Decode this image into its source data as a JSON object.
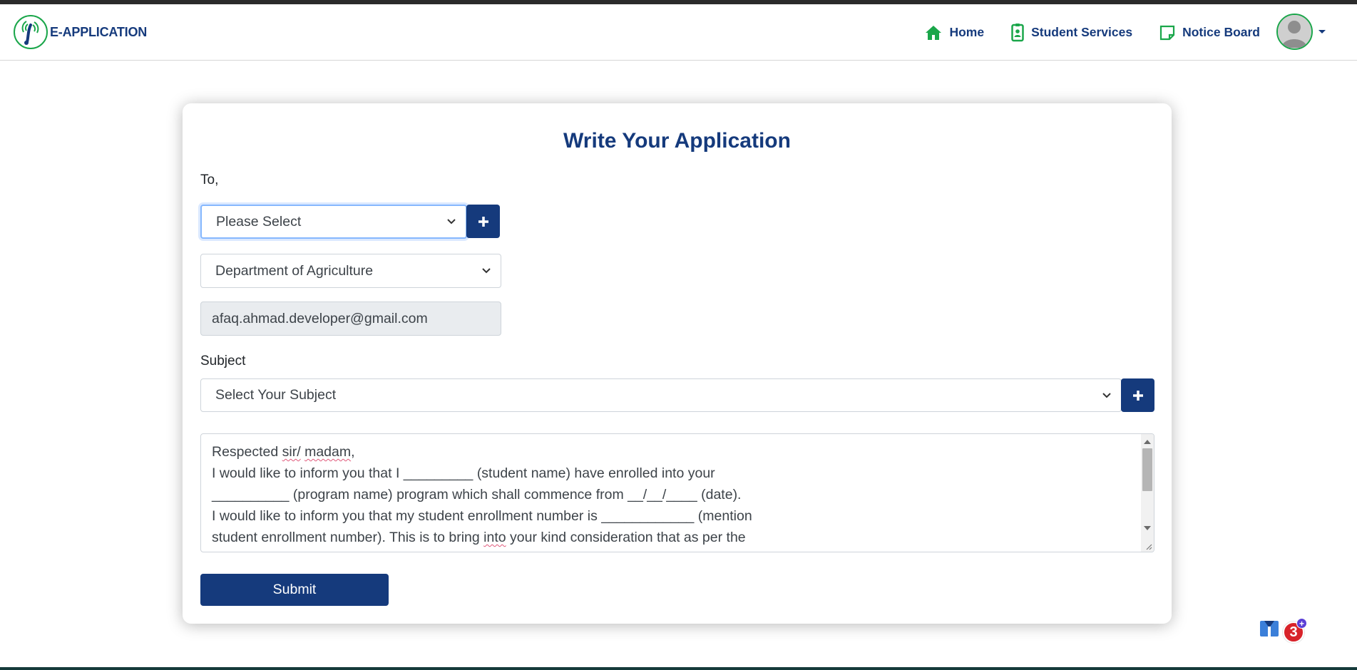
{
  "app": {
    "brand_name": "E-APPLICATION"
  },
  "nav": {
    "items": [
      {
        "label": "Home",
        "icon": "home-icon"
      },
      {
        "label": "Student Services",
        "icon": "id-badge-icon"
      },
      {
        "label": "Notice Board",
        "icon": "sticky-note-icon"
      }
    ],
    "user_menu_icon": "user-avatar"
  },
  "form": {
    "title": "Write Your Application",
    "to_label": "To,",
    "recipient_select": {
      "selected": "Please Select"
    },
    "department_select": {
      "selected": "Department of Agriculture"
    },
    "email_field": {
      "value": "afaq.ahmad.developer@gmail.com"
    },
    "subject_label": "Subject",
    "subject_select": {
      "selected": "Select Your Subject"
    },
    "body_lines": {
      "l1_a": "Respected ",
      "l1_sir": "sir/",
      "l1_sp": " ",
      "l1_madam": "madam",
      "l1_end": ",",
      "l2": "I would like to inform you that I _________ (student name) have enrolled into your",
      "l3": "__________ (program name) program which shall commence from __/__/____ (date).",
      "l4": "I would like to inform you that my student enrollment number is ____________ (mention",
      "l5_a": "student enrollment number). This is to bring ",
      "l5_into": "into",
      "l5_b": " your kind consideration that as per the"
    },
    "extension_badge_count": "3",
    "extension_badge_plus": "+",
    "submit_label": "Submit"
  },
  "colors": {
    "primary": "#153a7c",
    "accent_green": "#1aa64a",
    "badge_red": "#d8232a"
  }
}
